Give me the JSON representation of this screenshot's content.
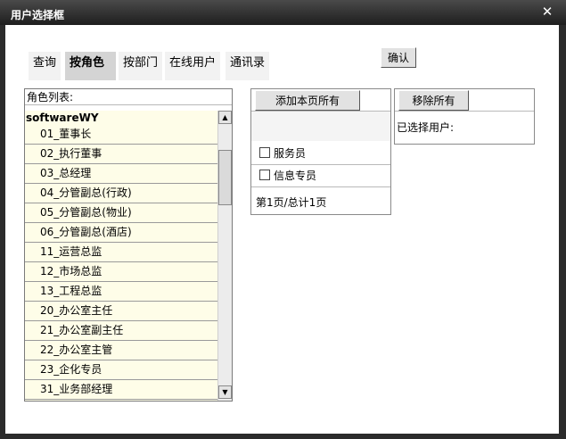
{
  "window": {
    "title": "用户选择框",
    "close_glyph": "✕"
  },
  "tabs": [
    {
      "label": "查询"
    },
    {
      "label": "按角色"
    },
    {
      "label": "按部门"
    },
    {
      "label": "在线用户"
    },
    {
      "label": "通讯录"
    }
  ],
  "confirm_label": "确认",
  "role_panel": {
    "header": "角色列表:",
    "root": "softwareWY",
    "items": [
      "01_董事长",
      "02_执行董事",
      "03_总经理",
      "04_分管副总(行政)",
      "05_分管副总(物业)",
      "06_分管副总(酒店)",
      "11_运营总监",
      "12_市场总监",
      "13_工程总监",
      "20_办公室主任",
      "21_办公室副主任",
      "22_办公室主管",
      "23_企化专员",
      "31_业务部经理"
    ],
    "scroll_up": "▲",
    "scroll_down": "▼"
  },
  "middle_panel": {
    "add_all_label": "添加本页所有",
    "users": [
      "服务员",
      "信息专员"
    ],
    "pager": "第1页/总计1页"
  },
  "right_panel": {
    "remove_all_label": "移除所有",
    "selected_label": "已选择用户:"
  }
}
